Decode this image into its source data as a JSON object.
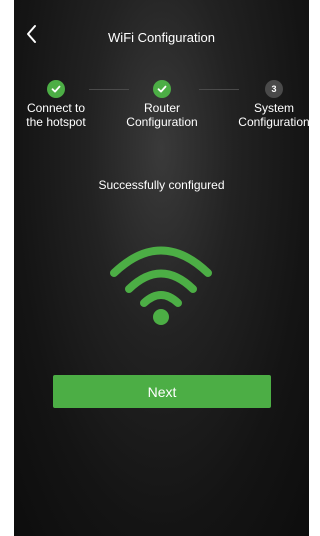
{
  "header": {
    "back_icon": "chevron-left-icon",
    "title": "WiFi Configuration"
  },
  "steps": [
    {
      "status": "done",
      "label": "Connect to\nthe hotspot"
    },
    {
      "status": "done",
      "label": "Router\nConfiguration"
    },
    {
      "status": "current",
      "number": "3",
      "label": "System\nConfiguration"
    }
  ],
  "status_message": "Successfully configured",
  "wifi_icon": "wifi-icon",
  "next_button": {
    "label": "Next"
  },
  "colors": {
    "accent": "#4cae45",
    "background": "#1a1a1a",
    "inactive_step": "#4a4a4a"
  }
}
